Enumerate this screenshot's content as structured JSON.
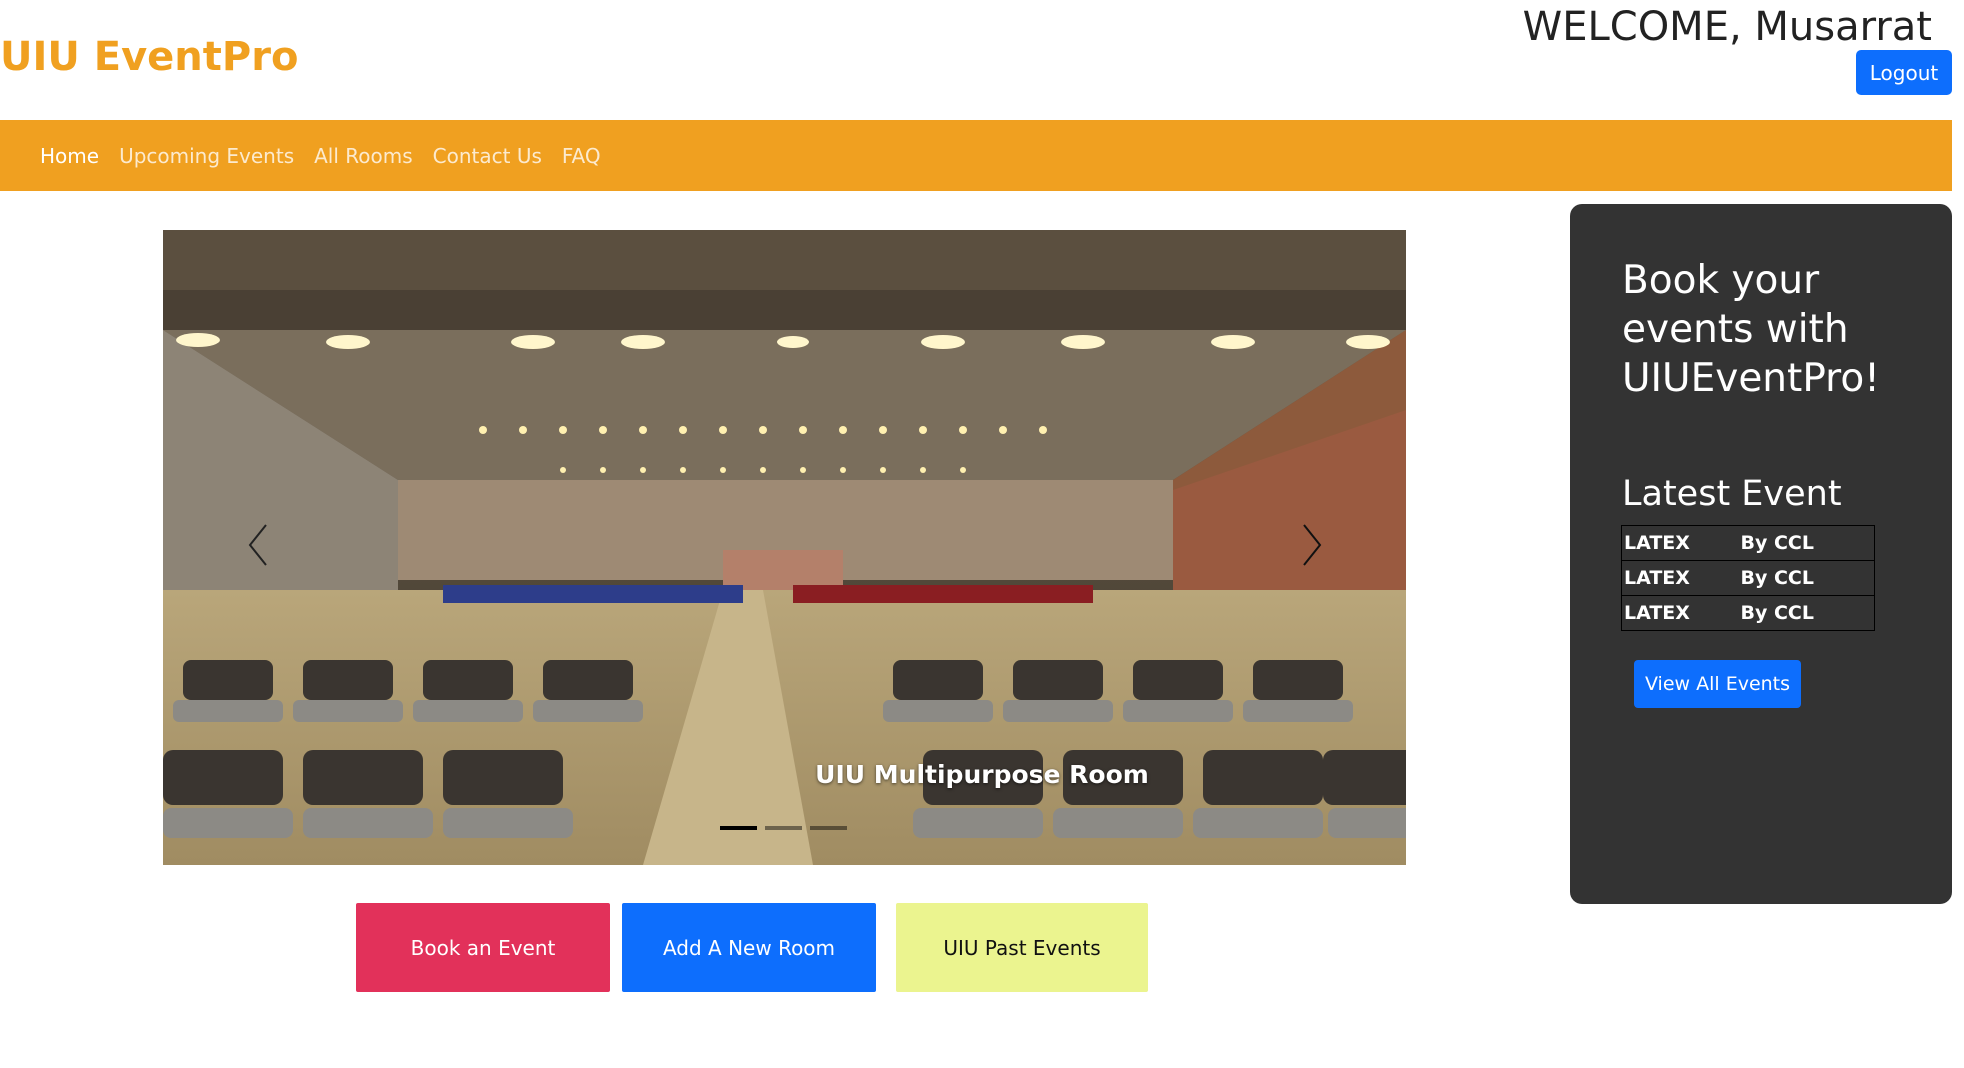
{
  "header": {
    "brand": "UIU EventPro",
    "welcome": "WELCOME, Musarrat",
    "logout_label": "Logout"
  },
  "nav": {
    "items": [
      {
        "label": "Home",
        "active": true
      },
      {
        "label": "Upcoming Events",
        "active": false
      },
      {
        "label": "All Rooms",
        "active": false
      },
      {
        "label": "Contact Us",
        "active": false
      },
      {
        "label": "FAQ",
        "active": false
      }
    ]
  },
  "carousel": {
    "caption": "UIU Multipurpose Room",
    "slide_count": 3,
    "active_slide": 1
  },
  "actions": {
    "book_label": "Book an Event",
    "add_room_label": "Add A New Room",
    "past_label": "UIU Past Events"
  },
  "sidebar": {
    "title": "Book your events with UIUEventPro!",
    "latest_heading": "Latest Event",
    "events": [
      {
        "name": "LATEX",
        "by": "By CCL"
      },
      {
        "name": "LATEX",
        "by": "By CCL"
      },
      {
        "name": "LATEX",
        "by": "By CCL"
      }
    ],
    "view_all_label": "View All Events"
  },
  "colors": {
    "brand": "#f0a020",
    "primary": "#0d6efd",
    "danger": "#e2315a",
    "warning_light": "#ebf48f",
    "panel": "#333333"
  },
  "icons": {
    "prev": "chevron-left-icon",
    "next": "chevron-right-icon"
  }
}
